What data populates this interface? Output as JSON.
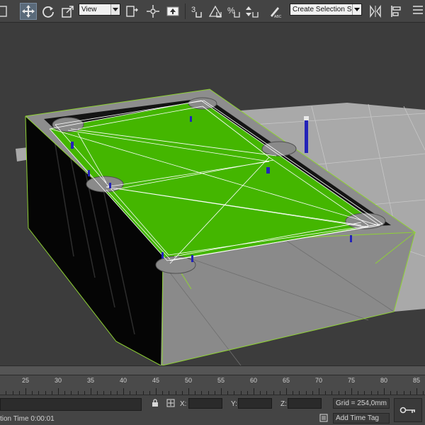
{
  "toolbar": {
    "view_select": "View",
    "snap_counter": "3",
    "selection_set_placeholder": "Create Selection Se",
    "buttons": [
      "select-box-icon",
      "move-icon",
      "rotate-icon",
      "scale-icon",
      "pivot-icon",
      "manipulate-icon",
      "keyboard-shortcut-icon",
      "snaps-toggle-icon",
      "angle-snap-icon",
      "percent-snap-icon",
      "spinner-snap-icon",
      "named-selection-icon",
      "mirror-icon",
      "align-icon"
    ]
  },
  "timeline": {
    "ticks": [
      25,
      30,
      35,
      40,
      45,
      50,
      55,
      60,
      65,
      70,
      75,
      80,
      85
    ]
  },
  "status": {
    "x_label": "X:",
    "y_label": "Y:",
    "z_label": "Z:",
    "grid": "Grid = 254,0mm",
    "add_time_tag": "Add Time Tag",
    "animation_time": "tion Time  0:00:01"
  },
  "colors": {
    "felt": "#44b600",
    "wire": "#ffffff",
    "edge_highlight": "#8fd234",
    "table_side": "#8c8c8c",
    "table_dark": "#050505",
    "pockets": "#8a8a8a",
    "ground": "#a9a9a9",
    "gizmo": "#2323b8"
  }
}
